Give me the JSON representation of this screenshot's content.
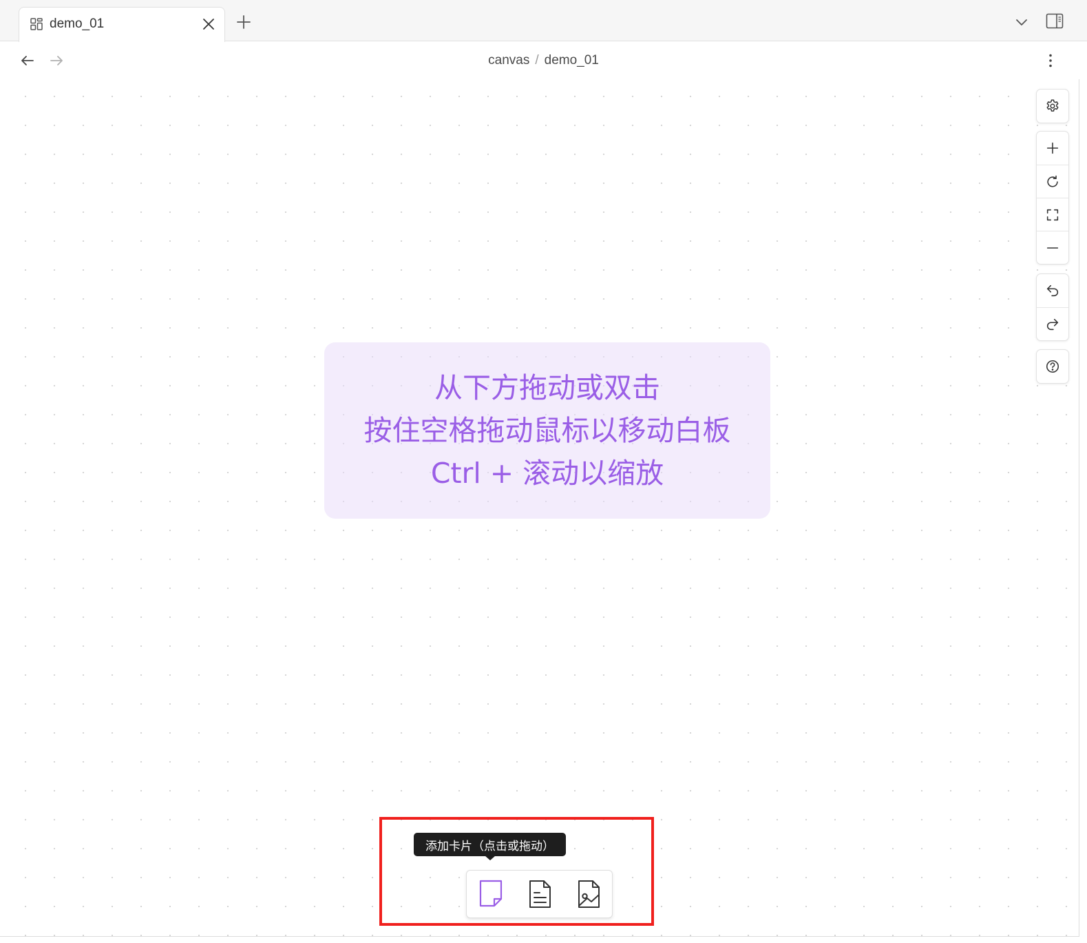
{
  "tab": {
    "title": "demo_01"
  },
  "breadcrumb": {
    "parent": "canvas",
    "separator": "/",
    "current": "demo_01"
  },
  "canvas_hint": {
    "lines": [
      "从下方拖动或双击",
      "按住空格拖动鼠标以移动白板",
      "Ctrl + 滚动以缩放"
    ],
    "color": "#9a5ee6"
  },
  "controls": {
    "settings": "gear-icon",
    "zoom": [
      "plus-icon",
      "reset-icon",
      "fullscreen-icon",
      "minus-icon"
    ],
    "history": [
      "undo-icon",
      "redo-icon"
    ],
    "help": "help-icon"
  },
  "card_toolbar": {
    "tooltip": "添加卡片（点击或拖动）",
    "tools": [
      "card-icon",
      "note-icon",
      "image-file-icon"
    ],
    "active_color": "#9a5ee6"
  },
  "annotation": {
    "frame_color": "#f0201d"
  }
}
